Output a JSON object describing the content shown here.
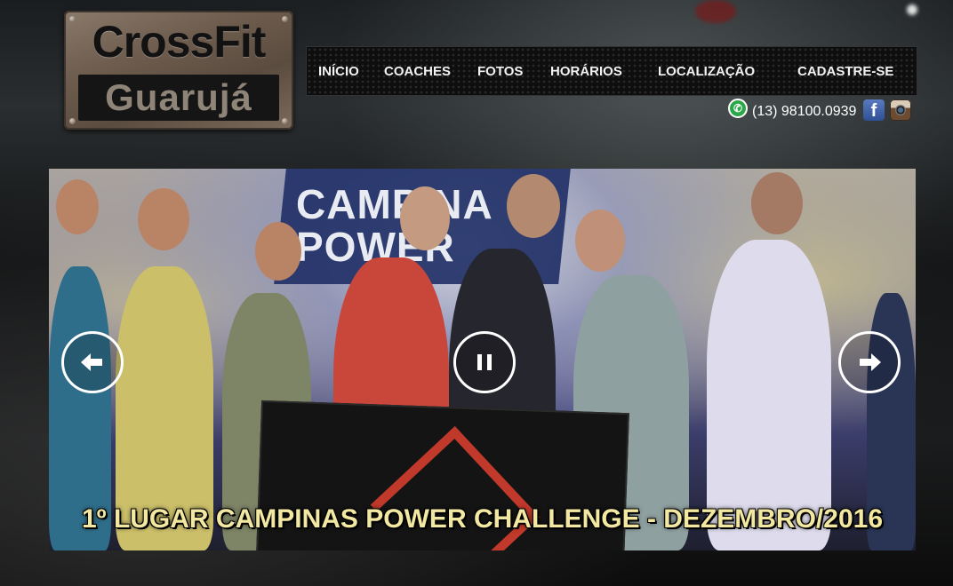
{
  "logo": {
    "title": "CrossFit",
    "subtitle": "Guarujá"
  },
  "nav": {
    "items": [
      {
        "label": "INÍCIO"
      },
      {
        "label": "COACHES"
      },
      {
        "label": "FOTOS"
      },
      {
        "label": "HORÁRIOS"
      },
      {
        "label": "LOCALIZAÇÃO"
      },
      {
        "label": "CADASTRE-SE"
      }
    ]
  },
  "contact": {
    "phone": "(13) 98100.0939",
    "icons": [
      "whatsapp-icon",
      "facebook-icon",
      "instagram-icon"
    ]
  },
  "slider": {
    "photo_banner_text": "CAMPINA\nPOWER",
    "caption": "1º LUGAR CAMPINAS POWER CHALLENGE - DEZEMBRO/2016",
    "controls": {
      "prev": "arrow-left-icon",
      "pause": "pause-icon",
      "next": "arrow-right-icon"
    }
  },
  "colors": {
    "caption": "#f3e8a2",
    "nav_bg": "#0e0e0e",
    "whatsapp": "#2aa848",
    "facebook": "#3b5998"
  }
}
